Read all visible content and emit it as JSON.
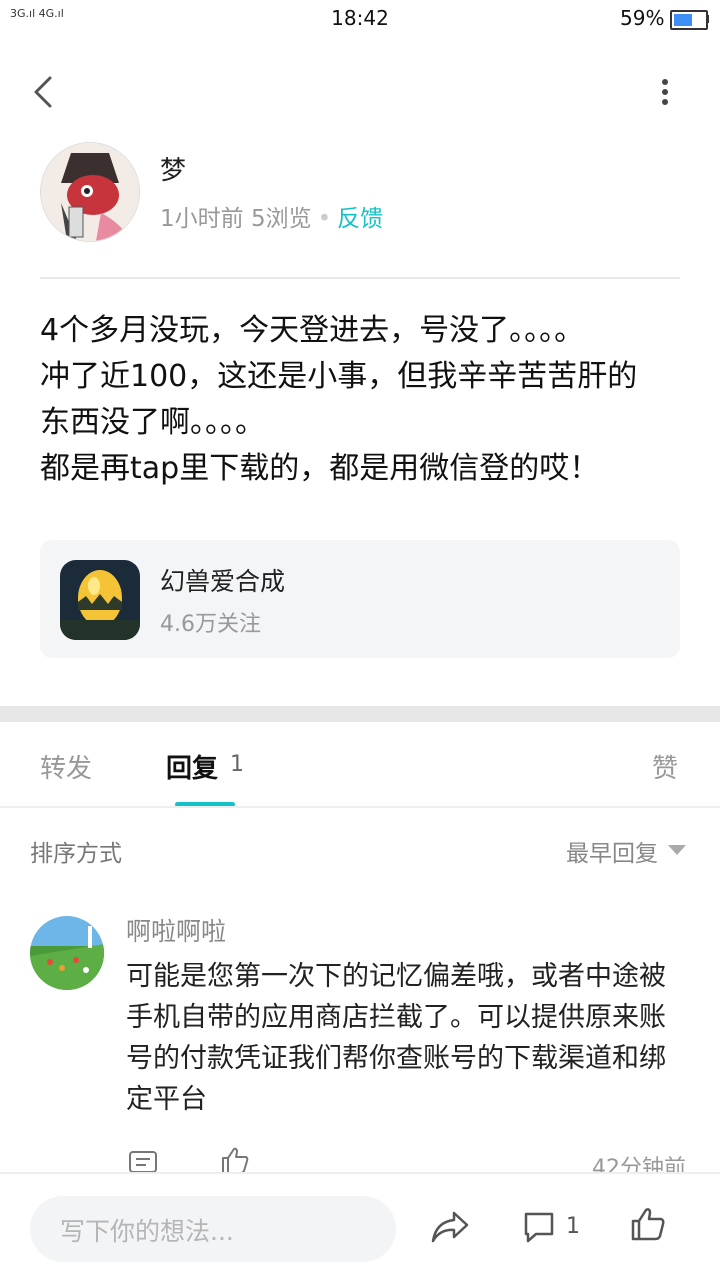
{
  "status_bar": {
    "signal": "3G.ıl 4G.ıl",
    "time": "18:42",
    "battery": "59%",
    "battery_level": 0.59
  },
  "header": {
    "back_icon": "back-chevron-icon",
    "more_icon": "more-vertical-icon"
  },
  "post": {
    "author": "梦",
    "time_ago": "1小时前",
    "views": "5浏览",
    "feedback": "反馈",
    "body": "4个多月没玩，今天登进去，号没了。。。。\n冲了近100，这还是小事，但我辛辛苦苦肝的\n东西没了啊。。。。\n都是再tap里下载的，都是用微信登的哎！"
  },
  "game": {
    "name": "幻兽爱合成",
    "followers": "4.6万关注"
  },
  "tabs": {
    "forward": "转发",
    "reply": "回复",
    "reply_count": "1",
    "like": "赞"
  },
  "sort": {
    "label": "排序方式",
    "value": "最早回复"
  },
  "comments": [
    {
      "name": "啊啦啊啦",
      "text": "可能是您第一次下的记忆偏差哦，或者中途被\n手机自带的应用商店拦截了。可以提供原来账\n号的付款凭证我们帮你查账号的下载渠道和绑\n定平台",
      "time": "42分钟前"
    }
  ],
  "bottom_bar": {
    "placeholder": "写下你的想法...",
    "comment_count": "1"
  },
  "colors": {
    "accent": "#15c1c7",
    "battery": "#3d8ff5"
  }
}
